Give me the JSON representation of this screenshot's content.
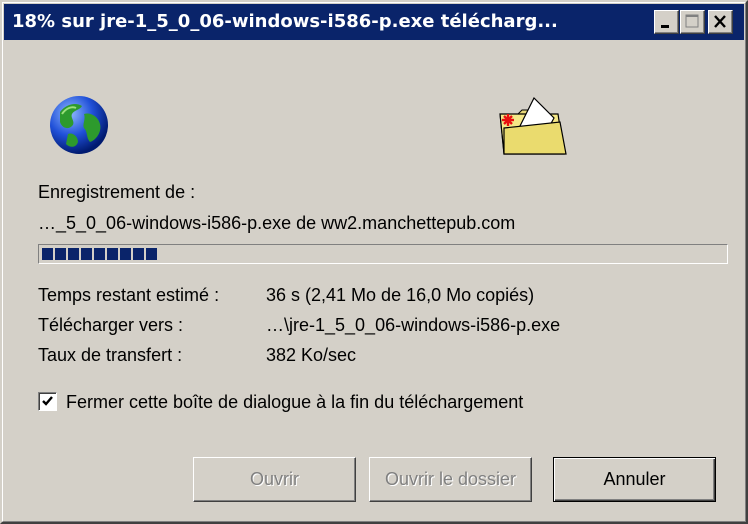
{
  "window": {
    "title": "18% sur jre-1_5_0_06-windows-i586-p.exe télécharg...",
    "controls": {
      "minimize": "minimize-icon",
      "maximize": "maximize-icon",
      "close": "close-icon"
    }
  },
  "icons": {
    "source": "globe-icon",
    "destination": "folder-icon"
  },
  "download": {
    "saving_label": "Enregistrement de :",
    "source": "…_5_0_06-windows-i586-p.exe de ww2.manchettepub.com",
    "progress_percent": 18,
    "time_left_label": "Temps restant estimé :",
    "time_left_value": "36 s (2,41 Mo de 16,0 Mo copiés)",
    "download_to_label": "Télécharger vers :",
    "download_to_value": "…\\jre-1_5_0_06-windows-i586-p.exe",
    "rate_label": "Taux de transfert :",
    "rate_value": "382 Ko/sec"
  },
  "options": {
    "close_on_complete_label": "Fermer cette boîte de dialogue à la fin du téléchargement",
    "close_on_complete_checked": true
  },
  "buttons": {
    "open": "Ouvrir",
    "open_folder": "Ouvrir le dossier",
    "cancel": "Annuler"
  },
  "colors": {
    "titlebar": "#0a246a",
    "progress": "#0a246a",
    "face": "#d4d0c8"
  }
}
